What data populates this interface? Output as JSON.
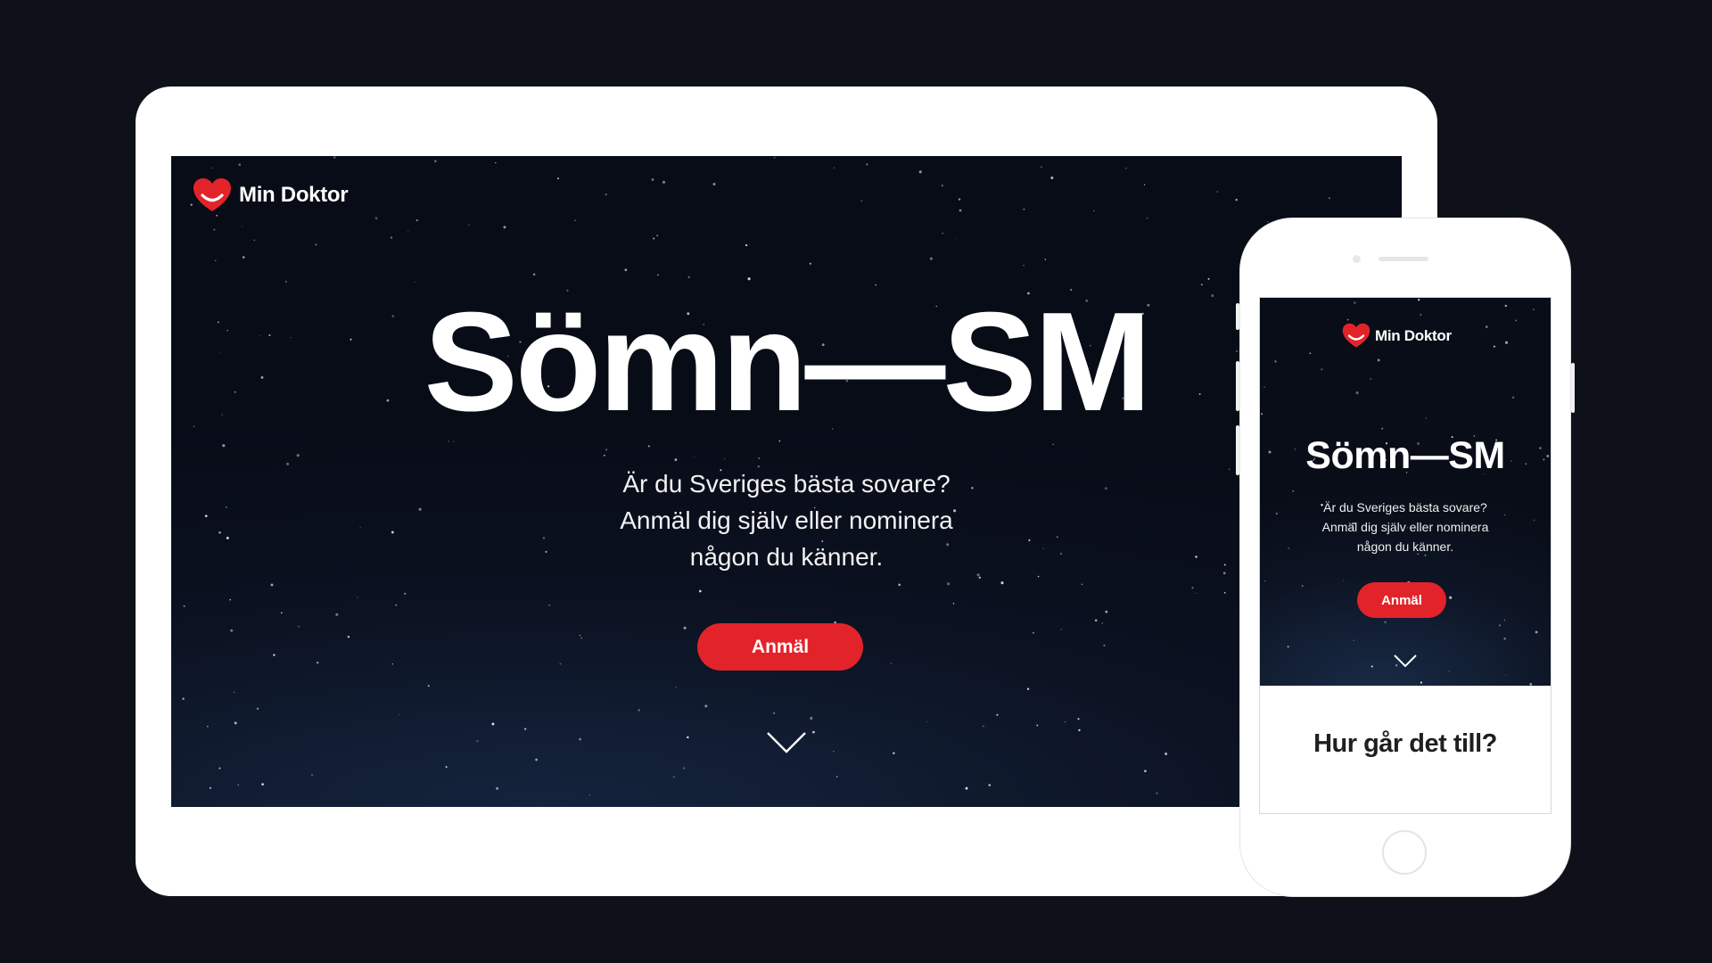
{
  "brand": {
    "name": "Min Doktor",
    "accent_color": "#e3232a",
    "logo_icon": "heart-smile-icon"
  },
  "tablet": {
    "hero": {
      "title": "Sömn—SM",
      "subtitle_lines": [
        "Är du Sveriges bästa sovare?",
        "Anmäl dig själv eller nominera",
        "någon du känner."
      ],
      "cta_label": "Anmäl",
      "scroll_icon": "chevron-down-icon"
    }
  },
  "phone": {
    "hero": {
      "title": "Sömn—SM",
      "subtitle_lines": [
        "Är du Sveriges bästa sovare?",
        "Anmäl dig själv eller nominera",
        "någon du känner."
      ],
      "cta_label": "Anmäl",
      "scroll_icon": "chevron-down-icon"
    },
    "section_title": "Hur går det till?"
  },
  "colors": {
    "page_background": "#0e1119",
    "hero_background": "#0b1120",
    "device_frame": "#ffffff"
  }
}
